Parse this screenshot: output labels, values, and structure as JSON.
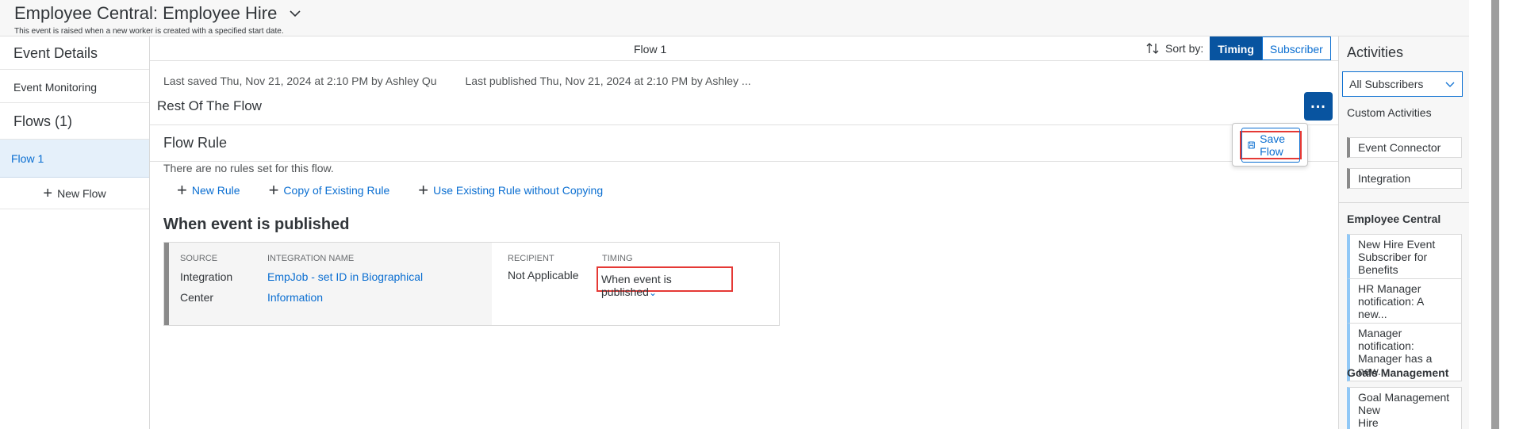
{
  "header": {
    "title": "Employee Central: Employee Hire",
    "subtitle": "This event is raised when a new worker is created with a specified start date."
  },
  "left_panel": {
    "event_details": "Event Details",
    "event_monitoring": "Event Monitoring",
    "flows_heading": "Flows (1)",
    "selected_flow": "Flow 1",
    "new_flow": "New Flow"
  },
  "center": {
    "flow_title": "Flow 1",
    "sort_label": "Sort by:",
    "sort_options": [
      "Timing",
      "Subscriber"
    ],
    "last_saved": "Last saved Thu, Nov 21, 2024 at 2:10 PM by Ashley Qu",
    "last_published": "Last published Thu, Nov 21, 2024 at 2:10 PM by Ashley ...",
    "rest_title": "Rest Of The Flow",
    "flow_rule_title": "Flow Rule",
    "no_rules": "There are no rules set for this flow.",
    "actions": [
      "New Rule",
      "Copy of Existing Rule",
      "Use Existing Rule without Copying"
    ],
    "when_title": "When event is published",
    "rule": {
      "source_label": "SOURCE",
      "source_value_line1": "Integration",
      "source_value_line2": "Center",
      "integration_label": "INTEGRATION NAME",
      "integration_line1": "EmpJob - set ID in Biographical",
      "integration_line2": "Information",
      "recipient_label": "RECIPIENT",
      "recipient_value": "Not Applicable",
      "timing_label": "TIMING",
      "timing_value": "When event is published"
    },
    "popover": {
      "save_flow": "Save Flow"
    }
  },
  "right_panel": {
    "title": "Activities",
    "filter_value": "All Subscribers",
    "custom_title": "Custom Activities",
    "custom_items": [
      "Event Connector",
      "Integration"
    ],
    "groups": [
      {
        "title": "Employee Central",
        "items": [
          [
            "New Hire Event",
            "Subscriber for Benefits"
          ],
          [
            "HR Manager",
            "notification: A new..."
          ],
          [
            "Manager notification:",
            "Manager has a new..."
          ]
        ]
      },
      {
        "title": "Goals Management",
        "items": [
          [
            "Goal Management New",
            "Hire"
          ]
        ]
      }
    ]
  },
  "colors": {
    "accent": "#0854a0",
    "link": "#0a6ed1",
    "highlight": "#e53935"
  }
}
